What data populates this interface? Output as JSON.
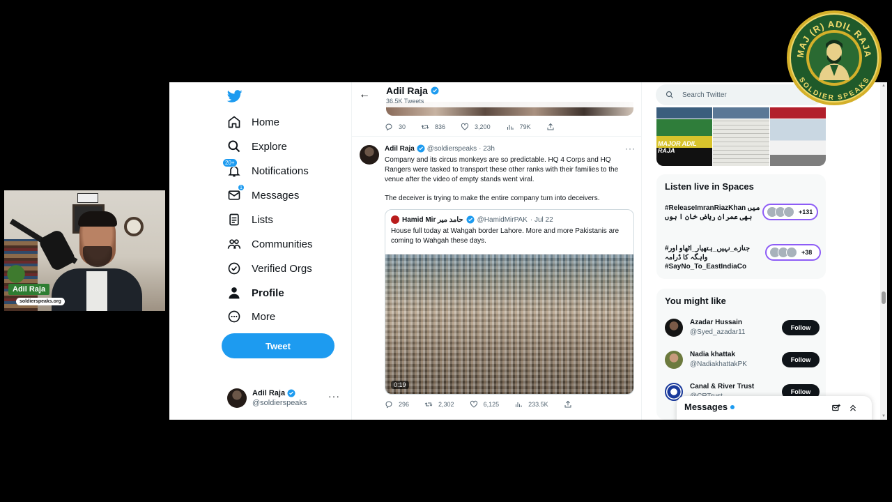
{
  "nav": {
    "items": [
      {
        "label": "Home"
      },
      {
        "label": "Explore"
      },
      {
        "label": "Notifications",
        "badge": "20+"
      },
      {
        "label": "Messages",
        "badge": "1"
      },
      {
        "label": "Lists"
      },
      {
        "label": "Communities"
      },
      {
        "label": "Verified Orgs"
      },
      {
        "label": "Profile"
      },
      {
        "label": "More"
      }
    ],
    "tweet_button": "Tweet",
    "user": {
      "name": "Adil Raja",
      "handle": "@soldierspeaks"
    }
  },
  "header": {
    "title": "Adil Raja",
    "subtitle": "36.5K Tweets"
  },
  "prev_tweet": {
    "replies": "30",
    "retweets": "836",
    "likes": "3,200",
    "views": "79K"
  },
  "tweet": {
    "name": "Adil Raja",
    "handle": "@soldierspeaks",
    "time": "· 23h",
    "text1": "Company and its circus monkeys are so predictable. HQ 4 Corps and HQ Rangers were tasked to transport these other ranks with their families to the venue after the video of empty stands went viral.",
    "text2": "The deceiver is trying to make the entire company turn into deceivers.",
    "quote": {
      "name": "Hamid Mir حامد میر",
      "handle": "@HamidMirPAK",
      "time": "· Jul 22",
      "text": "House full today at Wahgah border Lahore. More and more Pakistanis are coming to Wahgah these days.",
      "video_time": "0:19"
    },
    "replies": "296",
    "retweets": "2,302",
    "likes": "6,125",
    "views": "233.5K"
  },
  "right": {
    "search_placeholder": "Search Twitter",
    "media_caption": "MAJOR ADIL RAJA",
    "spaces": {
      "title": "Listen live in Spaces",
      "items": [
        {
          "title": "#ReleaseImranRiazKhan میں بھی عمران ریاض خان ا ہوں",
          "count": "+131"
        },
        {
          "title": "#جنازے_نہیں_ہتھیار_اٹھاو اور واہگہ کا ڈرامہ #SayNo_To_EastIndiaCo",
          "count": "+38"
        }
      ]
    },
    "might_like": {
      "title": "You might like",
      "people": [
        {
          "name": "Azadar Hussain",
          "handle": "@Syed_azadar11",
          "follow": "Follow"
        },
        {
          "name": "Nadia khattak",
          "handle": "@NadiakhattakPK",
          "follow": "Follow"
        },
        {
          "name": "Canal & River Trust",
          "handle": "@CRTrust",
          "follow": "Follow"
        }
      ]
    }
  },
  "messages_bar": {
    "title": "Messages"
  },
  "webcam": {
    "name": "Adil Raja",
    "url": "soldierspeaks.org"
  },
  "seal": {
    "top_text": "MAJ (R) ADIL RAJA",
    "bottom_text": "SOLDIER SPEAKS"
  },
  "colors": {
    "twitter_blue": "#1d9bf0",
    "text_primary": "#0f1419",
    "text_secondary": "#536471",
    "spaces_purple": "#8d5cf6",
    "seal_gold": "#d4b02a",
    "seal_green": "#1f5a2a"
  }
}
